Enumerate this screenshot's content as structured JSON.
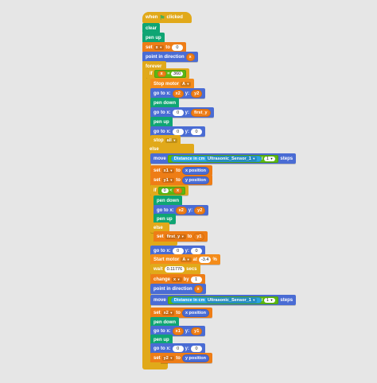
{
  "hat": {
    "when": "when",
    "clicked": "clicked",
    "flag": "⚑"
  },
  "s": {
    "clear": "clear",
    "pen_up": "pen up",
    "pen_down": "pen down",
    "set": "set",
    "to": "to",
    "point_dir": "point in direction",
    "forever": "forever",
    "if": "if",
    "else": "else",
    "stop_motor": "Stop motor",
    "go_to_x": "go to x:",
    "y": "y:",
    "stop": "stop",
    "move": "move",
    "distance": "Distance in cm",
    "steps": "steps",
    "x_position": "x position",
    "y_position": "y position",
    "start_motor": "Start motor",
    "at": "at",
    "pct": "%",
    "wait": "wait",
    "secs": "secs",
    "change": "change",
    "by": "by",
    "eq": "=",
    "lt": "<",
    "div": "/"
  },
  "v": {
    "x": "x",
    "x2": "x2",
    "y2": "y2",
    "x1": "x1",
    "y1": "y1",
    "first_y": "first_y",
    "all": "all",
    "A": "A",
    "n0": "0",
    "n360": "360",
    "n1": "1",
    "sensor": "Ultrasonic_Sensor_1",
    "speed": "-3.4",
    "wait": "0.11776",
    "one": "1"
  }
}
